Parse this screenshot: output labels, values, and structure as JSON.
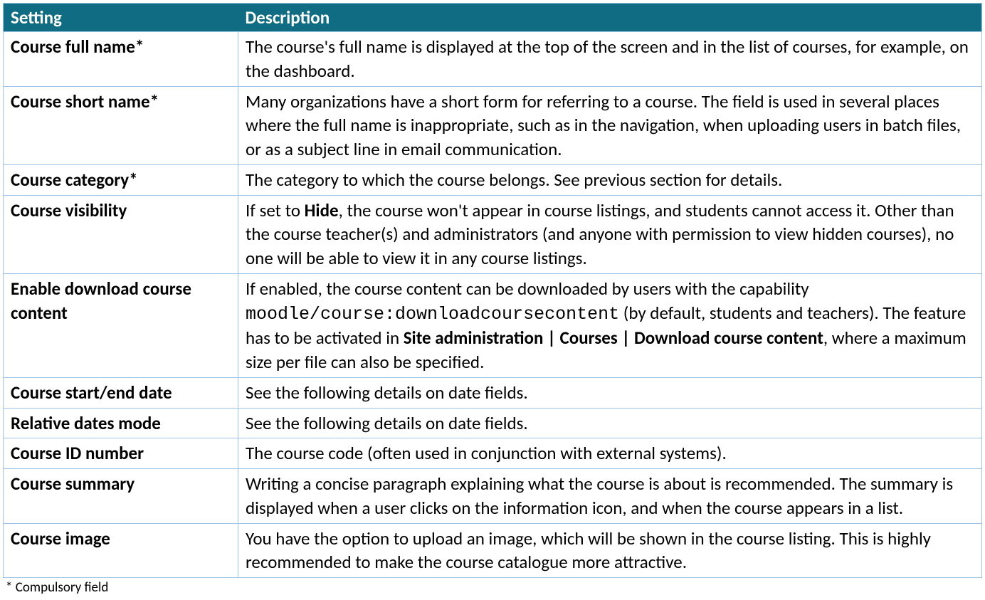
{
  "header": {
    "setting": "Setting",
    "description": "Description"
  },
  "rows": [
    {
      "setting": "Course full name*",
      "description": "The course's full name is displayed at the top of the screen and in the list of courses, for example, on the dashboard."
    },
    {
      "setting": "Course short name*",
      "description": "Many organizations have a short form for referring to a course. The field is used in several places where the full name is inappropriate, such as in the navigation, when uploading users in batch files, or as a subject line in email communication."
    },
    {
      "setting": "Course category*",
      "description": "The category to which the course belongs. See previous section for details."
    },
    {
      "setting": "Course visibility",
      "description_parts": {
        "pre": "If set to ",
        "bold": "Hide",
        "post": ", the course won't appear in course listings, and students cannot access it. Other than the course teacher(s) and administrators (and anyone with permission to view hidden courses), no one will be able to view it in any course listings."
      }
    },
    {
      "setting": "Enable download course content",
      "description_parts": {
        "pre": "If enabled, the course content can be downloaded by users with the capability ",
        "mono": "moodle/course:downloadcoursecontent",
        "mid": " (by default, students and teachers). The feature has to be activated in ",
        "bold": "Site administration | Courses | Download course content",
        "post": ", where a maximum size per file can also be specified."
      }
    },
    {
      "setting": "Course start/end date",
      "description": "See the following details on date fields."
    },
    {
      "setting": "Relative dates mode",
      "description": "See the following details on date fields."
    },
    {
      "setting": "Course ID number",
      "description": "The course code (often used in conjunction with external systems)."
    },
    {
      "setting": "Course summary",
      "description": "Writing a concise paragraph explaining what the course is about is recommended. The summary is displayed when a user clicks on the information icon, and when the course appears in a list."
    },
    {
      "setting": "Course image",
      "description": "You have the option to upload an image, which will be shown in the course listing. This is highly recommended to make the course catalogue more attractive."
    }
  ],
  "footnote": "* Compulsory field"
}
